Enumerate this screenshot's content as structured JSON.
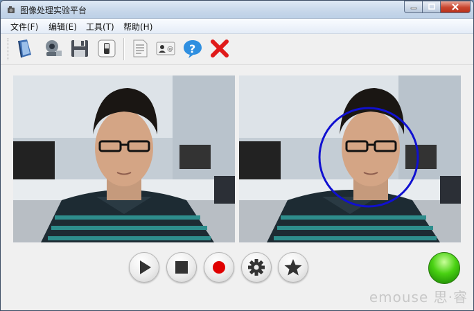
{
  "window": {
    "title": "图像处理实验平台"
  },
  "menu": [
    {
      "label": "文件(F)"
    },
    {
      "label": "编辑(E)"
    },
    {
      "label": "工具(T)"
    },
    {
      "label": "帮助(H)"
    }
  ],
  "toolbar": {
    "icons": [
      "open-icon",
      "camera-icon",
      "save-icon",
      "switch-icon",
      "document-icon",
      "contact-icon",
      "help-icon",
      "close-red-icon"
    ]
  },
  "controls": {
    "icons": [
      "play-icon",
      "stop-icon",
      "record-icon",
      "settings-icon",
      "star-icon"
    ],
    "status_color": "#3fc712"
  },
  "overlay": {
    "detection_color": "#1010d0"
  },
  "watermark": "emouse 思·睿"
}
